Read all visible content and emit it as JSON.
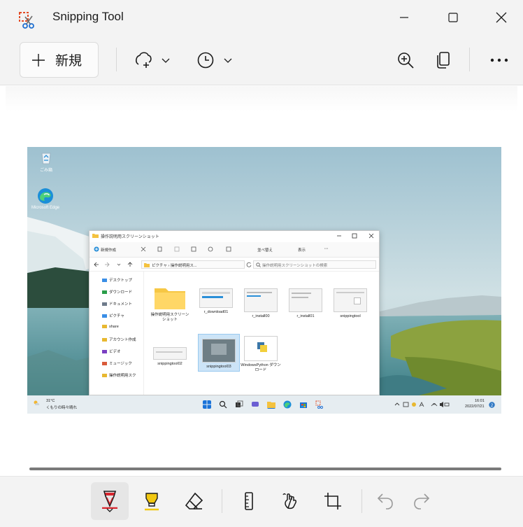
{
  "window": {
    "title": "Snipping Tool",
    "minimize_icon": "minimize-icon",
    "maximize_icon": "maximize-icon",
    "close_icon": "close-icon"
  },
  "toolbar": {
    "new_label": "新規",
    "snip_mode_icon": "freeform-snip-icon",
    "delay_icon": "timer-icon",
    "zoom_icon": "zoom-in-icon",
    "copy_icon": "copy-icon",
    "more_icon": "more-icon"
  },
  "screenshot": {
    "desktop_icons": [
      {
        "label": "ごみ箱",
        "icon": "recycle-bin-icon"
      },
      {
        "label": "Microsoft Edge",
        "icon": "edge-icon"
      }
    ],
    "explorer": {
      "title": "操作説明用スクリーンショット",
      "commands": [
        "新規作成",
        "並べ替え",
        "表示"
      ],
      "address": "ピクチャ › 操作説明用ス...",
      "search_placeholder": "操作説明用スクリーンショットの検索",
      "nav_items": [
        {
          "label": "デスクトップ",
          "color": "#3a8ee6"
        },
        {
          "label": "ダウンロード",
          "color": "#2a9d4a"
        },
        {
          "label": "ドキュメント",
          "color": "#6e7b8b"
        },
        {
          "label": "ピクチャ",
          "color": "#3a8ee6"
        },
        {
          "label": "share",
          "color": "#e8b830"
        },
        {
          "label": "アカウント作成",
          "color": "#e8b830"
        },
        {
          "label": "ビデオ",
          "color": "#7a3fc2"
        },
        {
          "label": "ミュージック",
          "color": "#d95a3a"
        },
        {
          "label": "操作説明用スク",
          "color": "#e8b830"
        }
      ],
      "files": [
        {
          "name": "操作説明用スクリーンショット",
          "kind": "folder"
        },
        {
          "name": "r_download01",
          "kind": "image"
        },
        {
          "name": "r_install00",
          "kind": "image"
        },
        {
          "name": "r_install01",
          "kind": "image"
        },
        {
          "name": "snippingtool",
          "kind": "image"
        },
        {
          "name": "snippingtool02",
          "kind": "image"
        },
        {
          "name": "snippingtool03",
          "kind": "image-selected"
        },
        {
          "name": "WindowsPython ダウンロード",
          "kind": "image"
        }
      ]
    },
    "taskbar": {
      "weather_temp": "31°C",
      "weather_desc": "くもりの時々晴れ",
      "time": "16:01",
      "date": "2022/07/21"
    }
  },
  "bottom_tools": [
    {
      "name": "pen",
      "icon": "ballpoint-pen-icon",
      "active": true
    },
    {
      "name": "highlighter",
      "icon": "highlighter-icon",
      "active": false
    },
    {
      "name": "eraser",
      "icon": "eraser-icon",
      "active": false
    },
    {
      "name": "ruler",
      "icon": "ruler-icon",
      "active": false
    },
    {
      "name": "touch-writing",
      "icon": "touch-writing-icon",
      "active": false
    },
    {
      "name": "crop",
      "icon": "crop-icon",
      "active": false
    },
    {
      "name": "undo",
      "icon": "undo-icon",
      "active": false
    },
    {
      "name": "redo",
      "icon": "redo-icon",
      "active": false
    }
  ],
  "colors": {
    "chrome_bg": "#f3f3f3",
    "pen_color": "#d9262f",
    "highlighter_color": "#f2c811"
  }
}
